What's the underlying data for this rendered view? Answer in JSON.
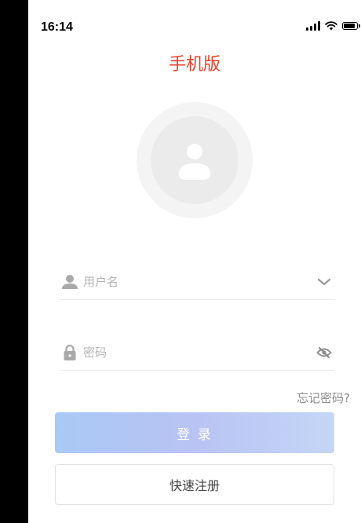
{
  "status_bar": {
    "time": "16:14",
    "icons": [
      "signal-icon",
      "wifi-icon",
      "battery-icon"
    ]
  },
  "app": {
    "title": "手机版",
    "title_color": "#e8412a"
  },
  "avatar": {
    "icon": "user-avatar-icon"
  },
  "form": {
    "username": {
      "placeholder": "用户名",
      "value": "",
      "icon": "user-icon",
      "trailing_icon": "chevron-down-icon"
    },
    "password": {
      "placeholder": "密码",
      "value": "",
      "icon": "lock-icon",
      "trailing_icon": "eye-off-icon"
    },
    "forgot_label": "忘记密码?",
    "login_label": "登 录",
    "register_label": "快速注册"
  },
  "colors": {
    "accent": "#e8412a",
    "login_gradient_start": "#a9c9f5",
    "login_gradient_end": "#c4d6f6"
  }
}
